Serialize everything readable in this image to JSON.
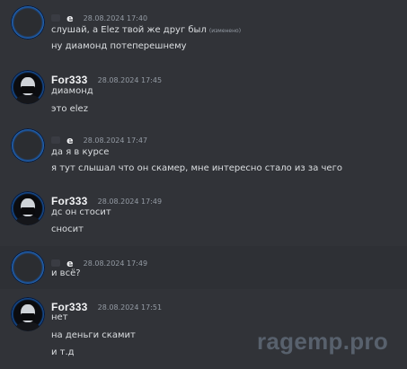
{
  "messages": [
    {
      "author": "e",
      "timestamp": "28.08.2024 17:40",
      "lines": [
        "слушай, а Elez твой же друг был",
        "ну диамонд потеперешнему"
      ],
      "edited_label": "(изменено)"
    },
    {
      "author": "For333",
      "timestamp": "28.08.2024 17:45",
      "lines": [
        "диамонд",
        "это elez"
      ]
    },
    {
      "author": "e",
      "timestamp": "28.08.2024 17:47",
      "lines": [
        "да я в курсе",
        "я тут слышал что он скамер, мне интересно стало из за чего"
      ]
    },
    {
      "author": "For333",
      "timestamp": "28.08.2024 17:49",
      "lines": [
        "дс он стосит",
        "сносит"
      ]
    },
    {
      "author": "e",
      "timestamp": "28.08.2024 17:49",
      "lines": [
        "и всё?"
      ]
    },
    {
      "author": "For333",
      "timestamp": "28.08.2024 17:51",
      "lines": [
        "нет",
        "на деньги скамит",
        "и т.д"
      ]
    }
  ],
  "watermark": "ragemp.pro",
  "colors": {
    "background": "#313338",
    "text": "#dbdee1",
    "author": "#f2f3f5",
    "timestamp": "#949ba4",
    "avatar_ring": "#1e6fd0"
  }
}
